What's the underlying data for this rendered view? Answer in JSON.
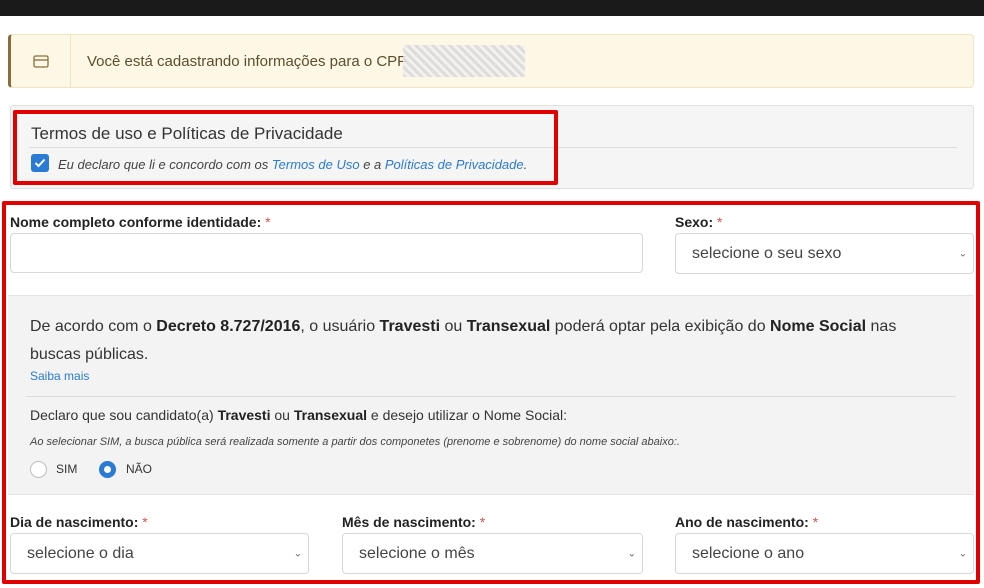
{
  "alert": {
    "icon": "card-icon",
    "text": "Você está cadastrando informações para o CPF"
  },
  "terms": {
    "title": "Termos de uso e Políticas de Privacidade",
    "checked": true,
    "text_prefix": "Eu declaro que li e concordo com os ",
    "terms_link": "Termos de Uso",
    "text_mid": " e a ",
    "privacy_link": "Políticas de Privacidade",
    "text_suffix": "."
  },
  "form": {
    "nome_label": "Nome completo conforme identidade:",
    "nome_value": "",
    "sexo_label": "Sexo:",
    "sexo_value": "selecione o seu sexo",
    "required_mark": "*",
    "dia_label": "Dia de nascimento:",
    "dia_value": "selecione o dia",
    "mes_label": "Mês de nascimento:",
    "mes_value": "selecione o mês",
    "ano_label": "Ano de nascimento:",
    "ano_value": "selecione o ano"
  },
  "social": {
    "p_1": "De acordo com o ",
    "decreto": "Decreto 8.727/2016",
    "p_2": ", o usuário ",
    "travesti": "Travesti",
    "ou": " ou ",
    "transexual": "Transexual",
    "p_3": " poderá optar pela exibição do ",
    "nome_social": "Nome Social",
    "p_4": " nas buscas públicas.",
    "saiba_mais": "Saiba mais",
    "declaro_1": "Declaro que sou candidato(a) ",
    "declaro_travesti": "Travesti",
    "declaro_ou": " ou ",
    "declaro_transexual": "Transexual",
    "declaro_2": " e desejo utilizar o Nome Social:",
    "note": "Ao selecionar SIM, a busca pública será realizada somente a partir dos componetes (prenome e sobrenome) do nome social abaixo:.",
    "radio_sim": "SIM",
    "radio_nao": "NÃO",
    "selected": "NÃO"
  },
  "colors": {
    "accent": "#2a7bd3",
    "highlight": "#e00000",
    "required": "#d9534f",
    "alert_bg": "#fdf8e6"
  }
}
